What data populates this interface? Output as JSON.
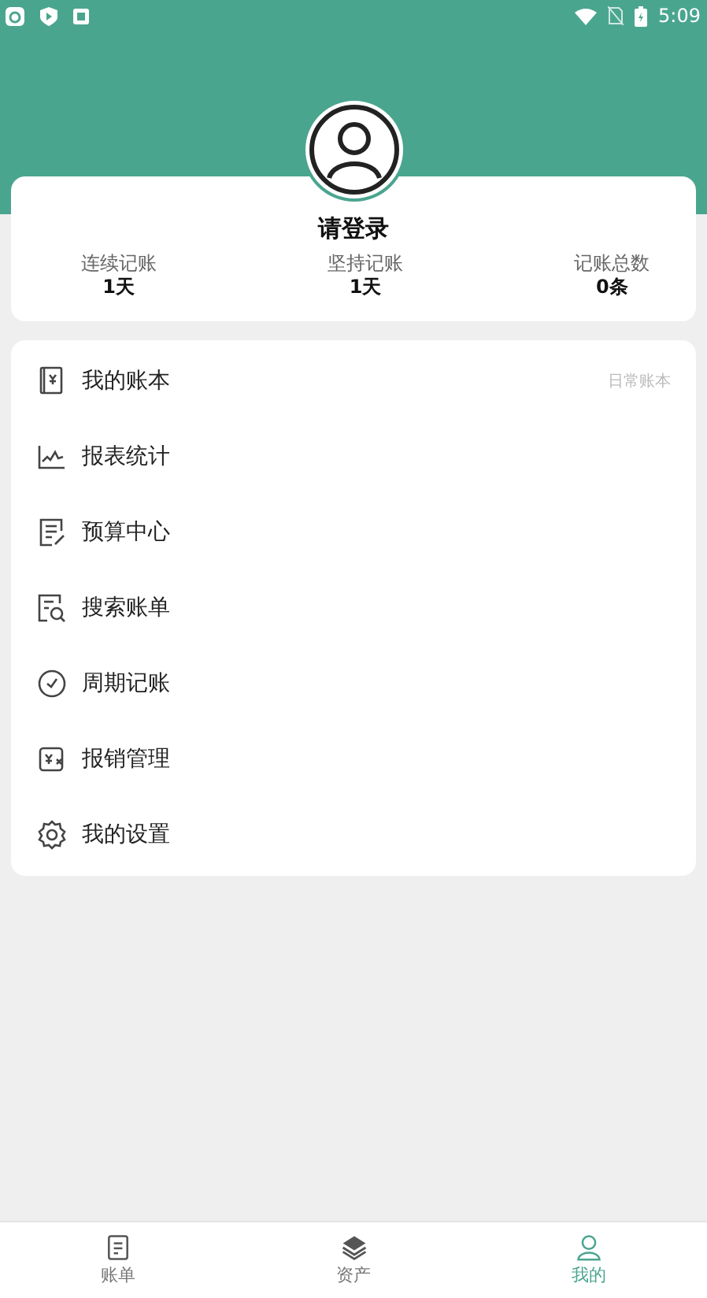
{
  "status_bar": {
    "time": "5:09"
  },
  "profile": {
    "title": "请登录",
    "stats": [
      {
        "label": "连续记账",
        "value": "1天"
      },
      {
        "label": "坚持记账",
        "value": "1天"
      },
      {
        "label": "记账总数",
        "value": "0条"
      }
    ]
  },
  "menu": [
    {
      "label": "我的账本",
      "value": "日常账本"
    },
    {
      "label": "报表统计"
    },
    {
      "label": "预算中心"
    },
    {
      "label": "搜索账单"
    },
    {
      "label": "周期记账"
    },
    {
      "label": "报销管理"
    },
    {
      "label": "我的设置"
    }
  ],
  "tabs": [
    {
      "label": "账单",
      "selected": false
    },
    {
      "label": "资产",
      "selected": false
    },
    {
      "label": "我的",
      "selected": true
    }
  ]
}
